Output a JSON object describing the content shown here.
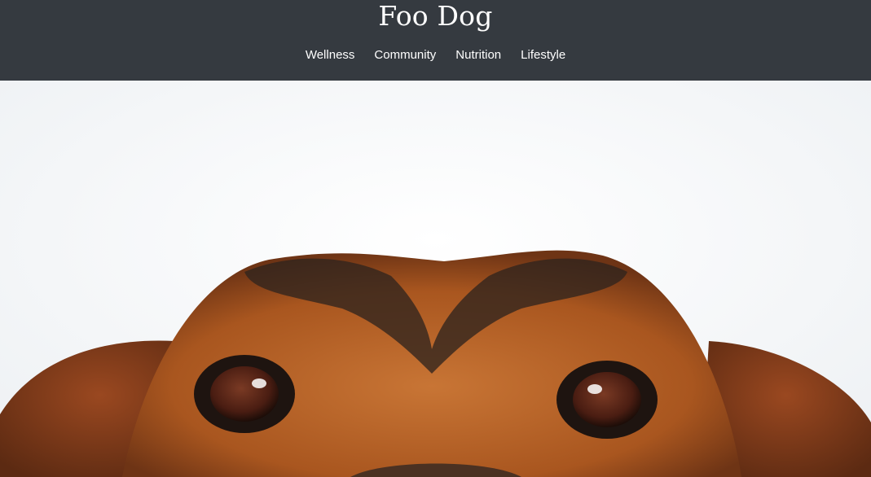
{
  "site": {
    "title": "Foo Dog"
  },
  "nav": {
    "items": [
      {
        "label": "Wellness"
      },
      {
        "label": "Community"
      },
      {
        "label": "Nutrition"
      },
      {
        "label": "Lifestyle"
      }
    ]
  },
  "hero": {
    "subject": "dog-photo"
  },
  "colors": {
    "header_bg": "#353a40",
    "header_text": "#ffffff",
    "hero_bg": "#f3f5f7",
    "fur_orange": "#b8622c",
    "fur_dark": "#2a211c",
    "eye": "#5a2a1c"
  }
}
